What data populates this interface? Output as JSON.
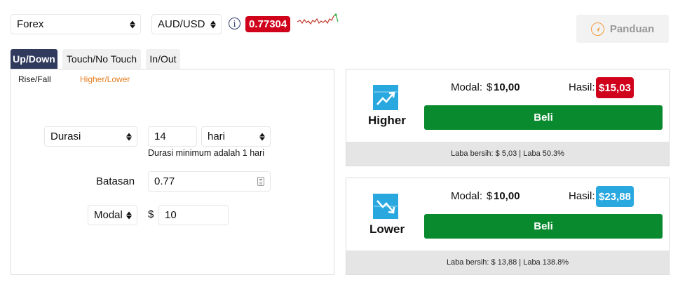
{
  "market": {
    "selected": "Forex"
  },
  "asset": {
    "selected": "AUD/USD"
  },
  "quote": {
    "price": "0.77304"
  },
  "guide": {
    "label": "Panduan"
  },
  "tabs": [
    {
      "label": "Up/Down"
    },
    {
      "label": "Touch/No Touch"
    },
    {
      "label": "In/Out"
    }
  ],
  "subtabs": [
    {
      "label": "Rise/Fall"
    },
    {
      "label": "Higher/Lower"
    }
  ],
  "form": {
    "duration_type": "Durasi",
    "duration_value": "14",
    "duration_unit": "hari",
    "duration_hint": "Durasi minimum adalah 1 hari",
    "barrier_label": "Batasan",
    "barrier_value": "0.77",
    "amount_type": "Modal",
    "currency_symbol": "$",
    "amount_value": "10"
  },
  "contracts": [
    {
      "direction": "Higher",
      "stake_label": "Modal:",
      "stake_currency": "$",
      "stake_value": "10,00",
      "payout_label": "Hasil:",
      "payout_currency": "$",
      "payout_value": "15,03",
      "payout_color": "#d0021b",
      "buy_label": "Beli",
      "footer": "Laba bersih: $ 5,03 | Laba 50.3%"
    },
    {
      "direction": "Lower",
      "stake_label": "Modal:",
      "stake_currency": "$",
      "stake_value": "10,00",
      "payout_label": "Hasil:",
      "payout_currency": "$",
      "payout_value": "23,88",
      "payout_color": "#29a8e0",
      "buy_label": "Beli",
      "footer": "Laba bersih: $ 13,88 | Laba 138.8%"
    }
  ],
  "colors": {
    "accent": "#e67e22",
    "tab_active": "#2f3a5d",
    "buy_button": "#0a8a2e",
    "price_badge": "#d0021b"
  },
  "icons": {
    "info": "info-icon",
    "guide": "compass-icon",
    "higher": "trend-up-icon",
    "lower": "trend-down-icon",
    "barrier": "calculator-icon"
  }
}
